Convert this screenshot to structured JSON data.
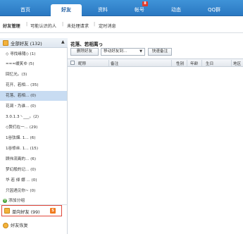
{
  "nav": {
    "tabs": [
      "首页",
      "好友",
      "资料",
      "帐号",
      "动态",
      "QQ群"
    ],
    "active_index": 1,
    "badge": "8"
  },
  "subnav": {
    "links": [
      "好友管理",
      "可能认识的人",
      "未处理请求",
      "定时消息"
    ],
    "separator": "|"
  },
  "sidebar": {
    "header_label": "全部好友 (132)",
    "header_caret": "▲",
    "groups": [
      "◇ 寻找缘隨◇ (1)",
      "≈≈≈缓笑ゆ (5)",
      "回忆光。(3)",
      "花开、若相... (35)",
      "花落、若相... (0)",
      "花凋・为谁... (0)",
      "3.0.1.3丶___。(2)",
      "◇赘们在一... (29)",
      "1谷弦烟. 1... (6)",
      "1谷修丝. 1... (15)",
      "顾伟流离的... (6)",
      "梦幻般的记... (0)",
      "华 若 倬 娜 ... (0)",
      "只因遇见你~ (0)"
    ],
    "selected_index": 4,
    "add_group": "添加分组",
    "oneway_label": "单向好友 (99)",
    "oneway_tag": "S",
    "restore_label": "好友恢复"
  },
  "main": {
    "group_title": "花落、若相离っ",
    "delete_button": "删除好友",
    "move_select": "移动好友到...",
    "move_arrow": "▼",
    "remark_button": "快速备注",
    "columns": [
      "昵称",
      "备注",
      "性别",
      "年龄",
      "生日",
      "地区"
    ]
  }
}
